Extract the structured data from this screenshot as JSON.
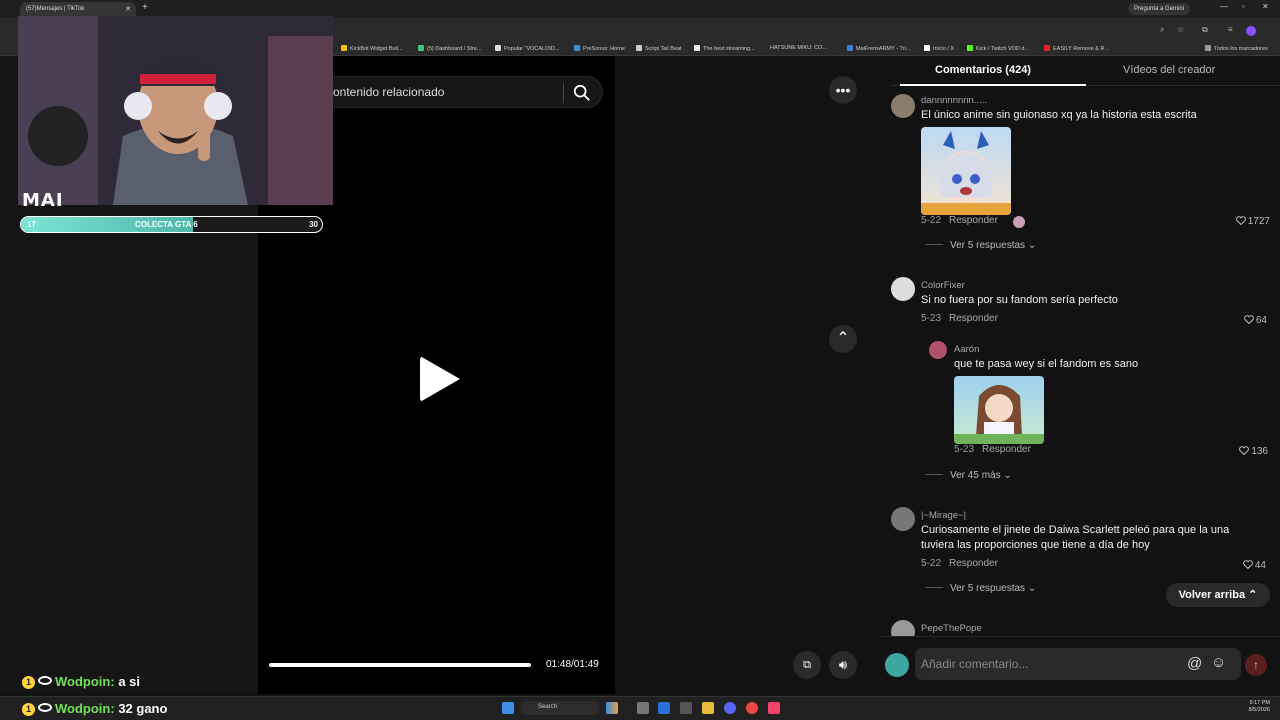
{
  "browser": {
    "tab_title": "(57)Mensajes | TikTok",
    "gemini_label": "Pregunta a Gemini",
    "bookmarks": [
      "KickBot Widget Buil...",
      "(5) Dashboard / Stre...",
      "Popular \"VOCALOID...",
      "PreSonus: Home",
      "Script Tail Beat",
      "The best streaming...",
      "HATSUNE MIKU: CO...",
      "MaiFrensARMY - Tri...",
      "Inicio / X",
      "Kick / Twitch VOD d...",
      "EASILY Remove & R..."
    ],
    "all_bookmarks": "Todos los marcadores"
  },
  "video": {
    "related_label": "ontenido relacionado",
    "time": "01:48/01:49"
  },
  "comments": {
    "tab_comments": "Comentarios (424)",
    "tab_creator": "Vídeos del creador",
    "reply_label": "Responder",
    "items": [
      {
        "user": "dannnnnnnn.....",
        "text": "El único anime sin guionaso xq ya la historia esta escrita",
        "date": "5-22",
        "likes": "1727",
        "more": "Ver 5 respuestas"
      },
      {
        "user": "ColorFixer",
        "text": "Si no fuera por su fandom sería perfecto",
        "date": "5-23",
        "likes": "64"
      },
      {
        "user": "Aarón",
        "text": "que te pasa wey si el fandom es sano",
        "date": "5-23",
        "likes": "136",
        "more": "Ver 45 más"
      },
      {
        "user": "|~Mirage~|",
        "text": "Curiosamente el jinete de Daiwa Scarlett peleó para que la una tuviera las proporciones que tiene a día de hoy",
        "date": "5-22",
        "likes": "44",
        "more": "Ver 5 respuestas"
      },
      {
        "user": "PepeThePope"
      }
    ],
    "back_top": "Volver arriba",
    "input_placeholder": "Añadir comentario..."
  },
  "overlay": {
    "streamer_name": "MAI",
    "goal_label": "COLECTA GTA 6",
    "goal_start": "17",
    "goal_end": "30",
    "goal_fraction": 0.57,
    "chat": [
      {
        "badge": "1",
        "nick": "Wodpoin:",
        "msg": "a si"
      },
      {
        "badge": "1",
        "nick": "Wodpoin:",
        "msg": "32 gano"
      }
    ]
  },
  "taskbar": {
    "search": "Search",
    "time": "9:17 PM",
    "date": "8/5/2026"
  }
}
